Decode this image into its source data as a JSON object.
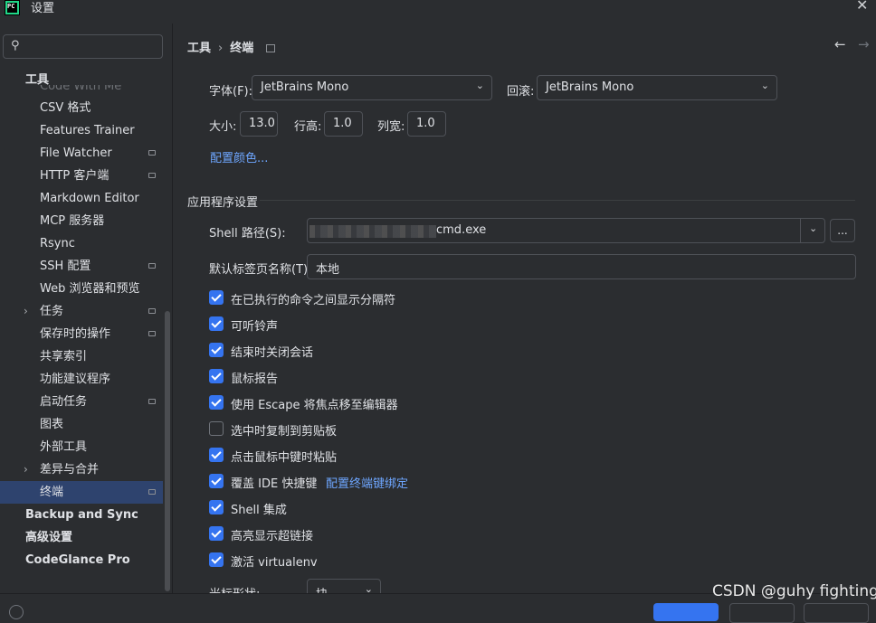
{
  "window": {
    "app_icon_text": "PC",
    "title": "设置",
    "close_glyph": "✕"
  },
  "sidebar": {
    "search": {
      "placeholder": "",
      "value": "",
      "icon": "search-icon"
    },
    "group_title": "工具",
    "clipped_item": "Code With Me",
    "items": [
      {
        "label": "CSV 格式",
        "has_mini": false,
        "chevron": false
      },
      {
        "label": "Features Trainer",
        "has_mini": false,
        "chevron": false
      },
      {
        "label": "File Watcher",
        "has_mini": true,
        "chevron": false
      },
      {
        "label": "HTTP 客户端",
        "has_mini": true,
        "chevron": false
      },
      {
        "label": "Markdown Editor",
        "has_mini": false,
        "chevron": false
      },
      {
        "label": "MCP 服务器",
        "has_mini": false,
        "chevron": false
      },
      {
        "label": "Rsync",
        "has_mini": false,
        "chevron": false
      },
      {
        "label": "SSH 配置",
        "has_mini": true,
        "chevron": false
      },
      {
        "label": "Web 浏览器和预览",
        "has_mini": false,
        "chevron": false
      },
      {
        "label": "任务",
        "has_mini": true,
        "chevron": true
      },
      {
        "label": "保存时的操作",
        "has_mini": true,
        "chevron": false
      },
      {
        "label": "共享索引",
        "has_mini": false,
        "chevron": false
      },
      {
        "label": "功能建议程序",
        "has_mini": false,
        "chevron": false
      },
      {
        "label": "启动任务",
        "has_mini": true,
        "chevron": false
      },
      {
        "label": "图表",
        "has_mini": false,
        "chevron": false
      },
      {
        "label": "外部工具",
        "has_mini": false,
        "chevron": false
      },
      {
        "label": "差异与合并",
        "has_mini": false,
        "chevron": true
      },
      {
        "label": "终端",
        "has_mini": true,
        "chevron": false,
        "selected": true
      }
    ],
    "top_level": [
      "Backup and Sync",
      "高级设置",
      "CodeGlance Pro"
    ]
  },
  "breadcrumb": {
    "parent": "工具",
    "separator": "›",
    "current": "终端"
  },
  "nav": {
    "back": "←",
    "forward": "→"
  },
  "font": {
    "font_label": "字体(F):",
    "font_value": "JetBrains Mono",
    "fallback_label": "回滚:",
    "fallback_value": "JetBrains Mono",
    "size_label": "大小:",
    "size_value": "13.0",
    "line_height_label": "行高:",
    "line_height_value": "1.0",
    "col_width_label": "列宽:",
    "col_width_value": "1.0",
    "colors_link": "配置颜色..."
  },
  "app_settings": {
    "section_title": "应用程序设置",
    "shell_label": "Shell 路径(S):",
    "shell_value": "cmd.exe",
    "browse_label": "...",
    "tab_name_label": "默认标签页名称(T):",
    "tab_name_value": "本地",
    "checkboxes": [
      {
        "label": "在已执行的命令之间显示分隔符",
        "checked": true
      },
      {
        "label": "可听铃声",
        "checked": true
      },
      {
        "label": "结束时关闭会话",
        "checked": true
      },
      {
        "label": "鼠标报告",
        "checked": true
      },
      {
        "label": "使用 Escape 将焦点移至编辑器",
        "checked": true
      },
      {
        "label": "选中时复制到剪贴板",
        "checked": false
      },
      {
        "label": "点击鼠标中键时粘贴",
        "checked": true
      },
      {
        "label": "覆盖 IDE 快捷键",
        "checked": true,
        "link": "配置终端键绑定"
      },
      {
        "label": "Shell 集成",
        "checked": true
      },
      {
        "label": "高亮显示超链接",
        "checked": true
      },
      {
        "label": "激活 virtualenv",
        "checked": true
      }
    ],
    "cursor_label": "光标形状:",
    "cursor_value": "块"
  },
  "arrow_glyph": "⌄",
  "watermark": "CSDN @guhy fighting"
}
